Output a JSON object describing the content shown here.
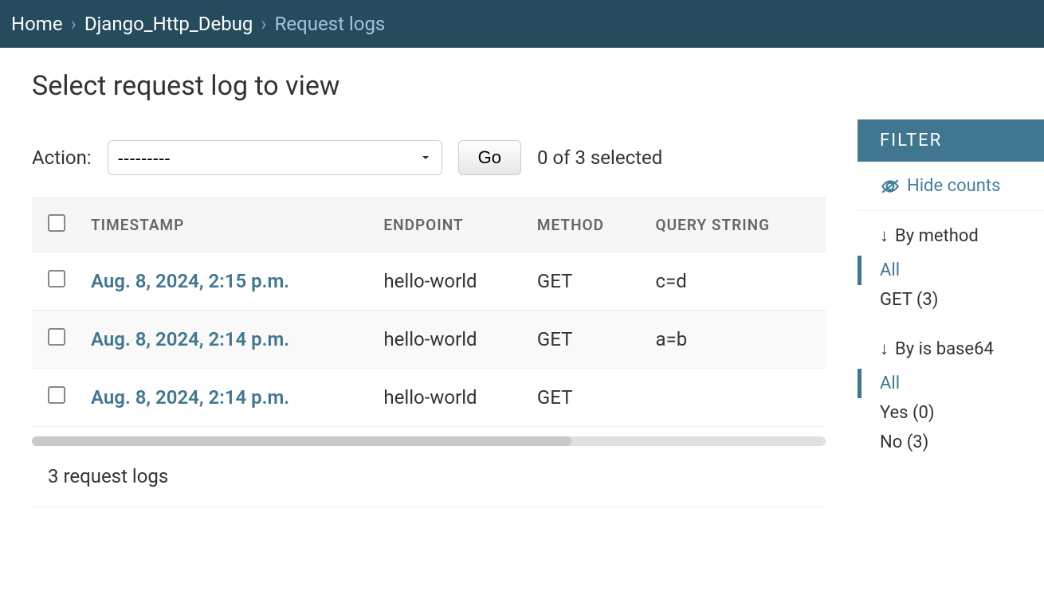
{
  "breadcrumbs": {
    "home": "Home",
    "app": "Django_Http_Debug",
    "current": "Request logs",
    "separator": "›"
  },
  "page_title": "Select request log to view",
  "actions": {
    "label": "Action:",
    "placeholder": "---------",
    "go_label": "Go",
    "selection_count": "0 of 3 selected"
  },
  "table": {
    "headers": {
      "timestamp": "TIMESTAMP",
      "endpoint": "ENDPOINT",
      "method": "METHOD",
      "query_string": "QUERY STRING"
    },
    "rows": [
      {
        "timestamp": "Aug. 8, 2024, 2:15 p.m.",
        "endpoint": "hello-world",
        "method": "GET",
        "query_string": "c=d"
      },
      {
        "timestamp": "Aug. 8, 2024, 2:14 p.m.",
        "endpoint": "hello-world",
        "method": "GET",
        "query_string": "a=b"
      },
      {
        "timestamp": "Aug. 8, 2024, 2:14 p.m.",
        "endpoint": "hello-world",
        "method": "GET",
        "query_string": ""
      }
    ]
  },
  "total_count": "3 request logs",
  "filter": {
    "header": "FILTER",
    "hide_counts": "Hide counts",
    "groups": [
      {
        "title": "By method",
        "options": [
          {
            "label": "All",
            "active": true
          },
          {
            "label": "GET (3)",
            "active": false
          }
        ]
      },
      {
        "title": "By is base64",
        "options": [
          {
            "label": "All",
            "active": true
          },
          {
            "label": "Yes (0)",
            "active": false
          },
          {
            "label": "No (3)",
            "active": false
          }
        ]
      }
    ]
  }
}
